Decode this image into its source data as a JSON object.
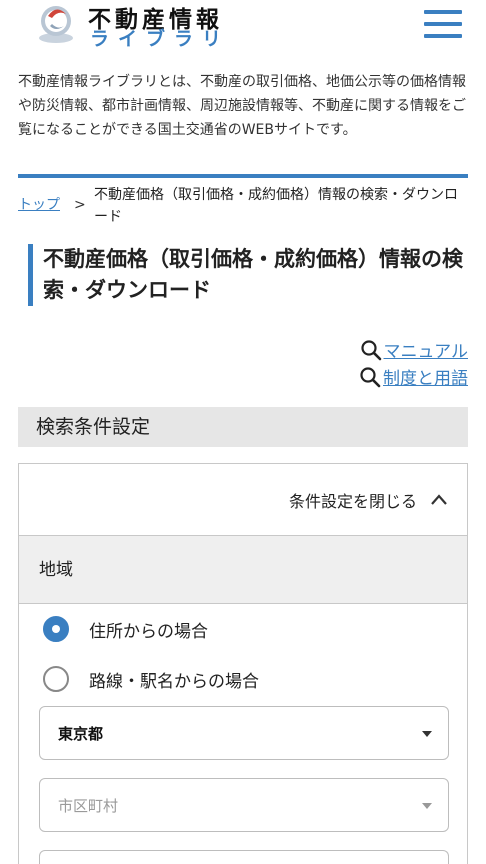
{
  "header": {
    "logo_line1": "不動産情報",
    "logo_line2": "ライブラリ",
    "menu_icon": "hamburger-menu-icon"
  },
  "intro": {
    "text": "不動産情報ライブラリとは、不動産の取引価格、地価公示等の価格情報や防災情報、都市計画情報、周辺施設情報等、不動産に関する情報をご覧になることができる国土交通省のWEBサイトです。"
  },
  "breadcrumb": {
    "home": "トップ",
    "separator": ">",
    "current": "不動産価格（取引価格・成約価格）情報の検索・ダウンロード"
  },
  "page": {
    "title": "不動産価格（取引価格・成約価格）情報の検索・ダウンロード"
  },
  "links": {
    "manual": "マニュアル",
    "terms": "制度と用語"
  },
  "search": {
    "section_title": "検索条件設定",
    "toggle_label": "条件設定を閉じる",
    "region_label": "地域",
    "radio_address": "住所からの場合",
    "radio_line": "路線・駅名からの場合",
    "prefecture_value": "東京都",
    "city_placeholder": "市区町村"
  },
  "colors": {
    "accent": "#3a7fc1",
    "section_bg": "#e6e6e6"
  }
}
